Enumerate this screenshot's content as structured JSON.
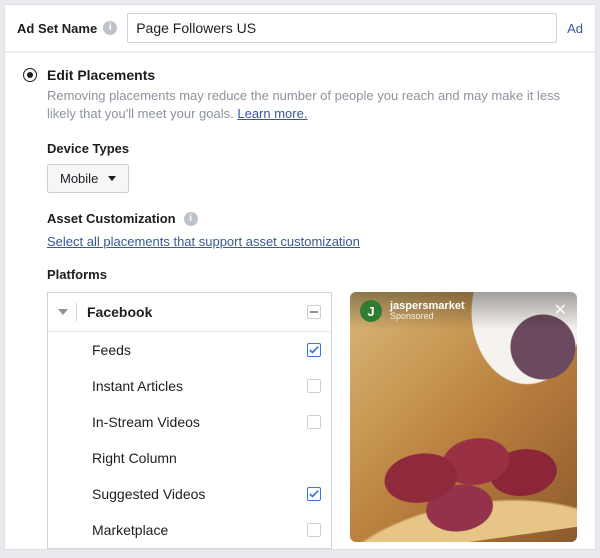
{
  "header": {
    "label": "Ad Set Name",
    "value": "Page Followers US",
    "right_link": "Ad"
  },
  "section": {
    "title": "Edit Placements",
    "description": "Removing placements may reduce the number of people you reach and may make it less likely that you'll meet your goals. ",
    "learn_more": "Learn more."
  },
  "device_types": {
    "label": "Device Types",
    "selected": "Mobile"
  },
  "asset_customization": {
    "label": "Asset Customization",
    "link": "Select all placements that support asset customization"
  },
  "platforms": {
    "label": "Platforms",
    "group": "Facebook",
    "items": [
      {
        "label": "Feeds",
        "checked": true
      },
      {
        "label": "Instant Articles",
        "checked": false
      },
      {
        "label": "In-Stream Videos",
        "checked": false
      },
      {
        "label": "Right Column",
        "checked": false,
        "no_checkbox": true
      },
      {
        "label": "Suggested Videos",
        "checked": true
      },
      {
        "label": "Marketplace",
        "checked": false
      }
    ]
  },
  "preview": {
    "brand": "jaspersmarket",
    "sponsored": "Sponsored"
  }
}
